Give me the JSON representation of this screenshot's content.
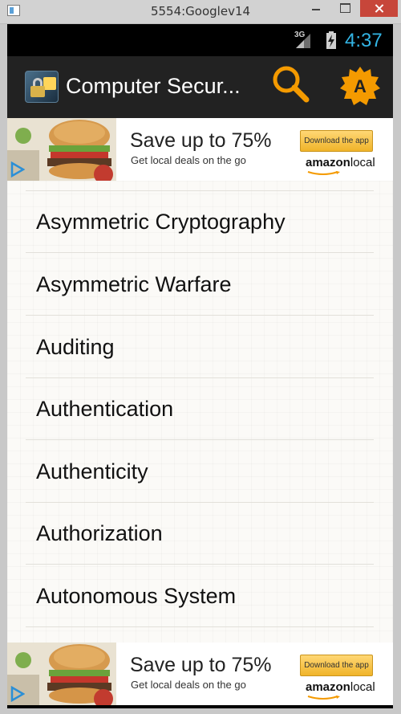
{
  "window": {
    "title": "5554:Googlev14"
  },
  "statusbar": {
    "network": "3G",
    "time": "4:37"
  },
  "actionbar": {
    "title": "Computer Secur...",
    "search_icon": "search-icon",
    "action_icon": "a-badge-icon"
  },
  "ad_top": {
    "headline": "Save up to 75%",
    "subtext": "Get local deals on the go",
    "cta": "Download the app",
    "brand": "amazon",
    "brand_suffix": "local"
  },
  "list": {
    "items": [
      {
        "label": "Asymmetric Cryptography"
      },
      {
        "label": "Asymmetric Warfare"
      },
      {
        "label": "Auditing"
      },
      {
        "label": "Authentication"
      },
      {
        "label": "Authenticity"
      },
      {
        "label": "Authorization"
      },
      {
        "label": "Autonomous System"
      }
    ]
  },
  "ad_bottom": {
    "headline": "Save up to 75%",
    "subtext": "Get local deals on the go",
    "cta": "Download the app",
    "brand": "amazon",
    "brand_suffix": "local"
  },
  "colors": {
    "actionbar": "#222222",
    "accent_orange": "#f49a00",
    "clock_blue": "#33b5e5",
    "list_bg": "#fbfaf7"
  }
}
